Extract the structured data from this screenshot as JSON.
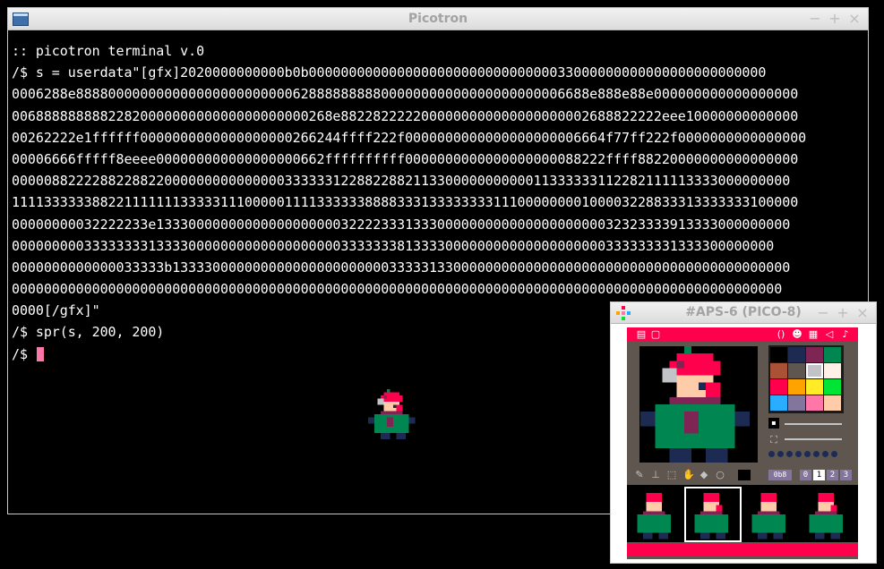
{
  "main_window": {
    "title": "Picotron",
    "controls": {
      "minimize": "−",
      "maximize": "+",
      "close": "×"
    }
  },
  "terminal": {
    "lines": [
      ":: picotron terminal v.0",
      "/$ s = userdata\"[gfx]2020000000000b0b000000000000000000000000000000033000000000000000000000000",
      "0006288e8888000000000000000000000006288888888800000000000000000000006688e888e88e000000000000000000",
      "0068888888882282000000000000000000000268e8822822222000000000000000000002688822222eee10000000000000",
      "00262222e1ffffff0000000000000000000266244ffff222f0000000000000000000006664f77ff222f0000000000000000",
      "00006666fffff8eeee000000000000000000662ffffffffff0000000000000000000088222ffff88220000000000000000",
      "0000088222288228822000000000000000333333122882288211330000000000011333333112282111113333000000000",
      "11113333338822111111133333111000001111333333888833313333333311100000000100003228833313333333100000",
      "00000000032222233e1333000000000000000000032222333133300000000000000000000032323333913333000000000",
      "00000000033333333133330000000000000000000333333381333300000000000000000000333333331333300000000",
      "0000000000000033333b13333000000000000000000000033333133000000000000000000000000000000000000000000",
      "000000000000000000000000000000000000000000000000000000000000000000000000000000000000000000000000",
      "0000[/gfx]\"",
      "/$ spr(s, 200, 200)",
      "/$ "
    ]
  },
  "sprite_editor": {
    "title": "#APS-6 (PICO-8)",
    "controls": {
      "minimize": "−",
      "maximize": "+",
      "close": "×"
    },
    "zoom_label": "0b8",
    "tabs": [
      "0",
      "1",
      "2",
      "3"
    ],
    "active_tab": "1",
    "palette": [
      "#000000",
      "#1d2b53",
      "#7e2553",
      "#008751",
      "#ab5236",
      "#5f574f",
      "#c2c3c7",
      "#fff1e8",
      "#ff004d",
      "#ffa300",
      "#ffec27",
      "#00e436",
      "#29adff",
      "#83769c",
      "#ff77a8",
      "#ffccaa"
    ],
    "selected_color_index": 6,
    "selected_thumb": 1
  },
  "colors": {
    "pico_red": "#ff004d",
    "pico_dark": "#5f574f",
    "cursor": "#ff77a8"
  }
}
